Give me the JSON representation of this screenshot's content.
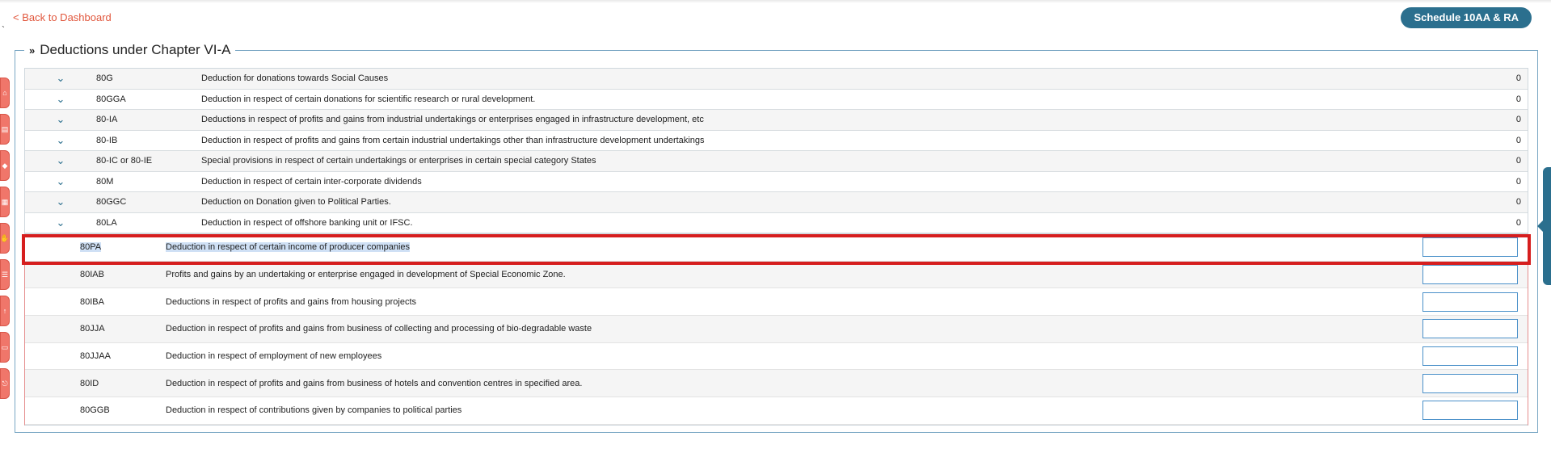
{
  "nav": {
    "back_label": "Back to Dashboard",
    "dot": "`"
  },
  "header": {
    "schedule_button": "Schedule 10AA & RA"
  },
  "section": {
    "title": "Deductions under Chapter VI-A",
    "chevron": "»"
  },
  "deductions": [
    {
      "code": "80G",
      "description": "Deduction for donations towards Social Causes",
      "value": "0"
    },
    {
      "code": "80GGA",
      "description": "Deduction in respect of certain donations for scientific research or rural development.",
      "value": "0"
    },
    {
      "code": "80-IA",
      "description": "Deductions in respect of profits and gains from industrial undertakings or enterprises engaged in infrastructure development, etc",
      "value": "0"
    },
    {
      "code": "80-IB",
      "description": "Deduction in respect of profits and gains from certain industrial undertakings other than infrastructure development undertakings",
      "value": "0"
    },
    {
      "code": "80-IC or 80-IE",
      "description": "Special provisions in respect of certain undertakings or enterprises in certain special category States",
      "value": "0"
    },
    {
      "code": "80M",
      "description": "Deduction in respect of certain inter-corporate dividends",
      "value": "0"
    },
    {
      "code": "80GGC",
      "description": "Deduction on Donation given to Political Parties.",
      "value": "0"
    },
    {
      "code": "80LA",
      "description": "Deduction in respect of offshore banking unit or IFSC.",
      "value": "0"
    }
  ],
  "sub_deductions": [
    {
      "code": "80PA",
      "description": "Deduction in respect of certain income of producer companies",
      "value": ""
    },
    {
      "code": "80IAB",
      "description": "Profits and gains by an undertaking or enterprise engaged in development of Special Economic Zone.",
      "value": ""
    },
    {
      "code": "80IBA",
      "description": "Deductions in respect of profits and gains from housing projects",
      "value": ""
    },
    {
      "code": "80JJA",
      "description": "Deduction in respect of profits and gains from business of collecting and processing of bio-degradable waste",
      "value": ""
    },
    {
      "code": "80JJAA",
      "description": "Deduction in respect of employment of new employees",
      "value": ""
    },
    {
      "code": "80ID",
      "description": "Deduction in respect of profits and gains from business of hotels and convention centres in specified area.",
      "value": ""
    },
    {
      "code": "80GGB",
      "description": "Deduction in respect of contributions given by companies to political parties",
      "value": ""
    }
  ],
  "colors": {
    "accent": "#2b6f8e",
    "link": "#e1573d",
    "highlight": "#d61e1e",
    "side_tab": "#f0766a"
  },
  "side_tabs": [
    "home-icon",
    "document-icon",
    "gift-icon",
    "form-icon",
    "hand-icon",
    "list-icon",
    "upload-icon",
    "file-icon",
    "exit-icon"
  ]
}
